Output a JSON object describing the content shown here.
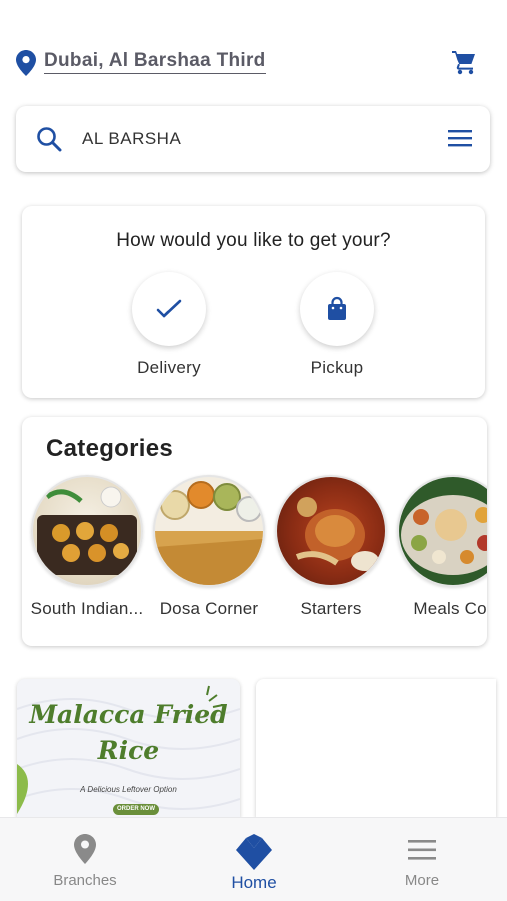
{
  "header": {
    "location": "Dubai, Al Barshaa Third",
    "icons": [
      "location-pin-icon",
      "cart-icon"
    ]
  },
  "search": {
    "value": "AL BARSHA",
    "icons": [
      "search-icon",
      "hamburger-menu-icon"
    ]
  },
  "order_mode": {
    "title": "How would you like to get your?",
    "options": [
      {
        "label": "Delivery",
        "icon": "checkmark-icon"
      },
      {
        "label": "Pickup",
        "icon": "shopping-bag-icon"
      }
    ]
  },
  "categories": {
    "title": "Categories",
    "items": [
      {
        "label": "South Indian..."
      },
      {
        "label": "Dosa Corner"
      },
      {
        "label": "Starters"
      },
      {
        "label": "Meals Cor"
      }
    ]
  },
  "promo": {
    "title": "Malacca Fried Rice",
    "subtitle": "A Delicious Leftover Option",
    "button": "ORDER NOW"
  },
  "bottom_nav": {
    "items": [
      {
        "label": "Branches",
        "icon": "map-pin-icon"
      },
      {
        "label": "Home",
        "icon": "home-logo-icon"
      },
      {
        "label": "More",
        "icon": "menu-icon"
      }
    ]
  },
  "colors": {
    "accent": "#1f4fa3",
    "nav_inactive": "#888888",
    "promo_green": "#4e7d2c"
  }
}
